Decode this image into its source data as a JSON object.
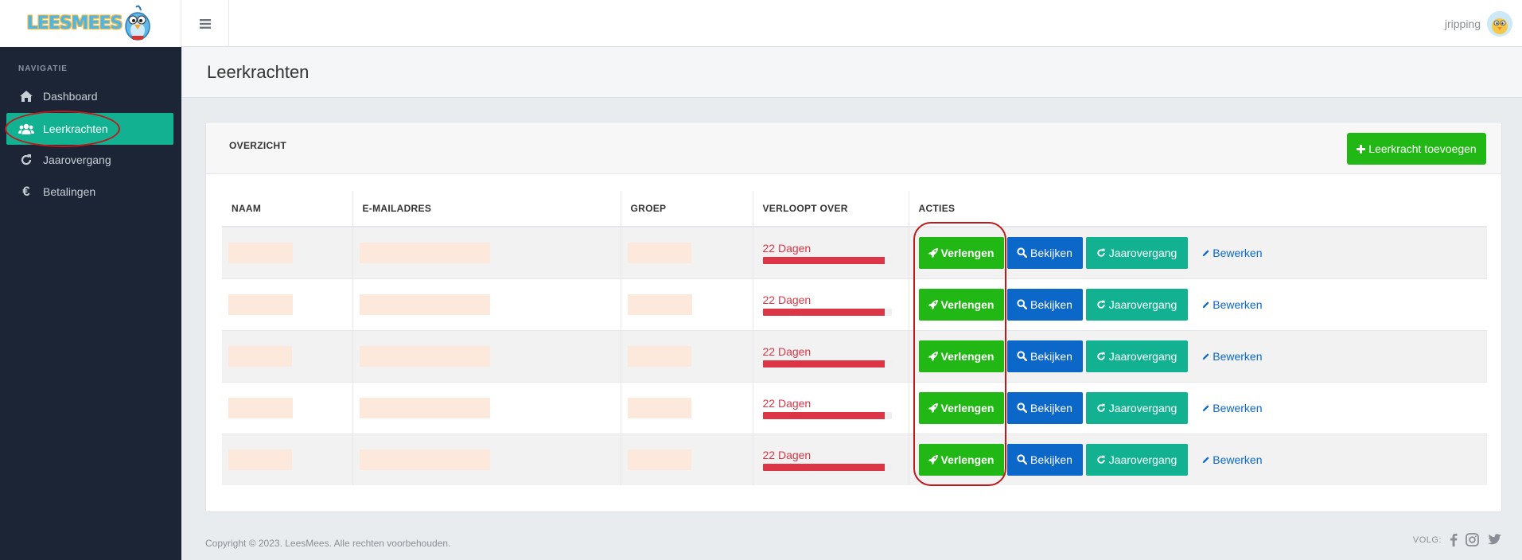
{
  "header": {
    "logo_text": "LEESMEES",
    "username": "jripping"
  },
  "sidebar": {
    "title": "NAVIGATIE",
    "items": [
      {
        "label": "Dashboard",
        "icon": "home-icon",
        "active": false
      },
      {
        "label": "Leerkrachten",
        "icon": "users-icon",
        "active": true
      },
      {
        "label": "Jaarovergang",
        "icon": "refresh-icon",
        "active": false
      },
      {
        "label": "Betalingen",
        "icon": "euro-icon",
        "active": false
      }
    ]
  },
  "page": {
    "title": "Leerkrachten"
  },
  "card": {
    "title": "OVERZICHT",
    "add_button": "Leerkracht toevoegen"
  },
  "table": {
    "headers": {
      "name": "NAAM",
      "email": "E-MAILADRES",
      "group": "GROEP",
      "expires": "VERLOOPT OVER",
      "actions": "ACTIES"
    },
    "rows": [
      {
        "expires": "22 Dagen",
        "progress": 0.95
      },
      {
        "expires": "22 Dagen",
        "progress": 0.95
      },
      {
        "expires": "22 Dagen",
        "progress": 0.95
      },
      {
        "expires": "22 Dagen",
        "progress": 0.95
      },
      {
        "expires": "22 Dagen",
        "progress": 0.95
      }
    ],
    "action_labels": {
      "extend": "Verlengen",
      "view": "Bekijken",
      "year": "Jaarovergang",
      "edit": "Bewerken"
    }
  },
  "footer": {
    "copyright": "Copyright © 2023. LeesMees. Alle rechten voorbehouden.",
    "follow": "VOLG:"
  },
  "colors": {
    "sidebar_bg": "#1c2535",
    "active_nav": "#11b191",
    "green": "#21b815",
    "blue": "#0b67c8",
    "teal": "#11b191",
    "danger": "#dc3545"
  }
}
